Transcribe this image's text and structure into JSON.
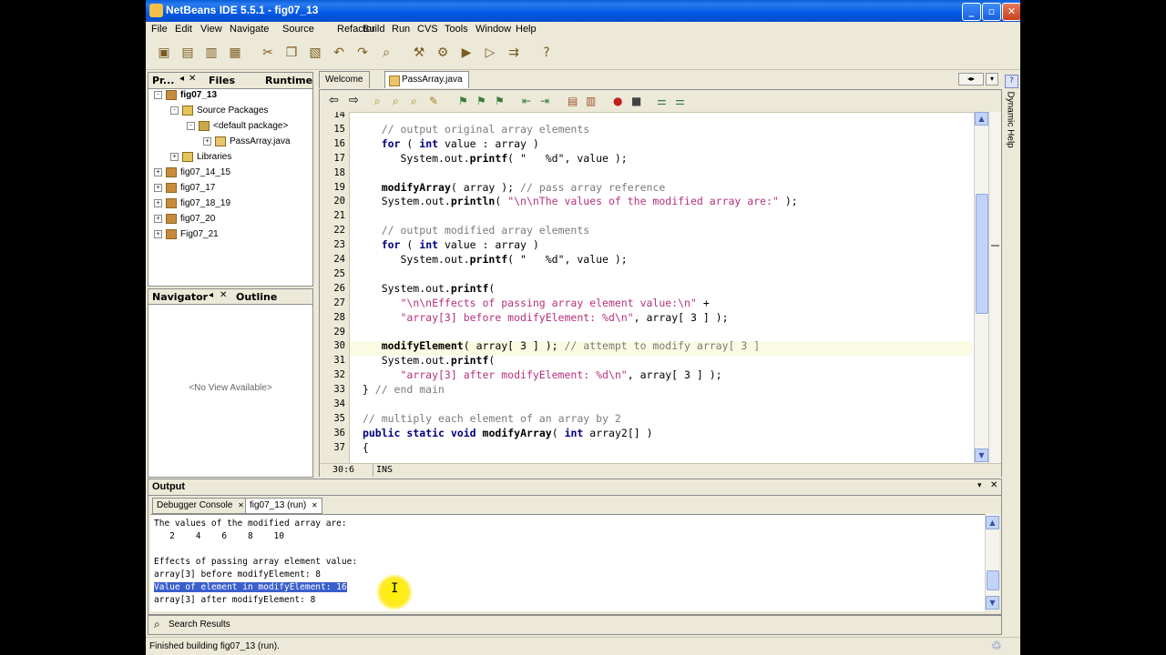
{
  "window": {
    "title": "NetBeans IDE 5.5.1 - fig07_13"
  },
  "menu": [
    "File",
    "Edit",
    "View",
    "Navigate",
    "Source",
    "Refactor",
    "Build",
    "Run",
    "CVS",
    "Tools",
    "Window",
    "Help"
  ],
  "projects": {
    "tabs": [
      "Pr...",
      "Files",
      "Runtime"
    ],
    "tree": [
      {
        "label": "fig07_13",
        "indent": 0,
        "bold": true,
        "exp": "-",
        "icon": "project-icon"
      },
      {
        "label": "Source Packages",
        "indent": 1,
        "exp": "-",
        "icon": "folder-icon"
      },
      {
        "label": "<default package>",
        "indent": 2,
        "exp": "-",
        "icon": "package-icon"
      },
      {
        "label": "PassArray.java",
        "indent": 3,
        "exp": "+",
        "icon": "java-file-icon"
      },
      {
        "label": "Libraries",
        "indent": 1,
        "exp": "+",
        "icon": "folder-icon"
      },
      {
        "label": "fig07_14_15",
        "indent": 0,
        "exp": "+",
        "icon": "project-icon"
      },
      {
        "label": "fig07_17",
        "indent": 0,
        "exp": "+",
        "icon": "project-icon"
      },
      {
        "label": "fig07_18_19",
        "indent": 0,
        "exp": "+",
        "icon": "project-icon"
      },
      {
        "label": "fig07_20",
        "indent": 0,
        "exp": "+",
        "icon": "project-icon"
      },
      {
        "label": "Fig07_21",
        "indent": 0,
        "exp": "+",
        "icon": "project-icon"
      }
    ]
  },
  "navigator": {
    "tabs": [
      "Navigator",
      "Outline"
    ],
    "empty": "<No View Available>"
  },
  "editor": {
    "tabs": [
      "Welcome",
      "PassArray.java"
    ],
    "first_line": 14,
    "lines": [
      [],
      [
        [
          "    ",
          ""
        ],
        [
          "// output original array elements",
          "cm"
        ]
      ],
      [
        [
          "    ",
          ""
        ],
        [
          "for",
          "kw"
        ],
        [
          " ( ",
          ""
        ],
        [
          "int",
          "kw"
        ],
        [
          " value : array )",
          ""
        ]
      ],
      [
        [
          "       System.out.",
          ""
        ],
        [
          "printf",
          "md"
        ],
        [
          "( ",
          ""
        ],
        [
          "\"   %d\"",
          ""
        ],
        [
          ", value );",
          ""
        ]
      ],
      [],
      [
        [
          "    ",
          ""
        ],
        [
          "modifyArray",
          "md"
        ],
        [
          "( array ); ",
          ""
        ],
        [
          "// pass array reference",
          "cm"
        ]
      ],
      [
        [
          "    System.out.",
          ""
        ],
        [
          "println",
          "md"
        ],
        [
          "( ",
          ""
        ],
        [
          "\"\\n\\nThe values of the modified array are:\"",
          "st"
        ],
        [
          " );",
          ""
        ]
      ],
      [],
      [
        [
          "    ",
          ""
        ],
        [
          "// output modified array elements",
          "cm"
        ]
      ],
      [
        [
          "    ",
          ""
        ],
        [
          "for",
          "kw"
        ],
        [
          " ( ",
          ""
        ],
        [
          "int",
          "kw"
        ],
        [
          " value : array )",
          ""
        ]
      ],
      [
        [
          "       System.out.",
          ""
        ],
        [
          "printf",
          "md"
        ],
        [
          "( ",
          ""
        ],
        [
          "\"   %d\"",
          ""
        ],
        [
          ", value );",
          ""
        ]
      ],
      [],
      [
        [
          "    System.out.",
          ""
        ],
        [
          "printf",
          "md"
        ],
        [
          "(",
          ""
        ]
      ],
      [
        [
          "       ",
          ""
        ],
        [
          "\"\\n\\nEffects of passing array element value:\\n\"",
          "st"
        ],
        [
          " +",
          ""
        ]
      ],
      [
        [
          "       ",
          ""
        ],
        [
          "\"array[3] before modifyElement: %d\\n\"",
          "st"
        ],
        [
          ", array[ 3 ] );",
          ""
        ]
      ],
      [],
      [
        [
          "    ",
          ""
        ],
        [
          "modifyElement",
          "md"
        ],
        [
          "( array[ 3 ] ); ",
          ""
        ],
        [
          "// attempt to modify array[ 3 ]",
          "cm"
        ]
      ],
      [
        [
          "    System.out.",
          ""
        ],
        [
          "printf",
          "md"
        ],
        [
          "(",
          ""
        ]
      ],
      [
        [
          "       ",
          ""
        ],
        [
          "\"array[3] after modifyElement: %d\\n\"",
          "st"
        ],
        [
          ", array[ 3 ] );",
          ""
        ]
      ],
      [
        [
          " } ",
          ""
        ],
        [
          "// end main",
          "cm"
        ]
      ],
      [],
      [
        [
          " ",
          ""
        ],
        [
          "// multiply each element of an array by 2",
          "cm"
        ]
      ],
      [
        [
          " ",
          ""
        ],
        [
          "public",
          "kw"
        ],
        [
          " ",
          ""
        ],
        [
          "static",
          "kw"
        ],
        [
          " ",
          ""
        ],
        [
          "void",
          "kw"
        ],
        [
          " ",
          ""
        ],
        [
          "modifyArray",
          "md"
        ],
        [
          "( ",
          ""
        ],
        [
          "int",
          "kw"
        ],
        [
          " array2[] )",
          ""
        ]
      ],
      [
        [
          " {",
          ""
        ]
      ]
    ],
    "status": {
      "position": "30:6",
      "mode": "INS"
    }
  },
  "output": {
    "title": "Output",
    "tabs": [
      "Debugger Console",
      "fig07_13 (run)"
    ],
    "lines": [
      "The values of the modified array are:",
      "   2    4    6    8    10",
      "",
      "Effects of passing array element value:",
      "array[3] before modifyElement: 8",
      "Value of element in modifyElement: 16",
      "array[3] after modifyElement: 8"
    ],
    "highlight_index": 5
  },
  "search_results": "Search Results",
  "dynamic_help": "Dynamic Help",
  "statusbar": "Finished building fig07_13 (run)."
}
